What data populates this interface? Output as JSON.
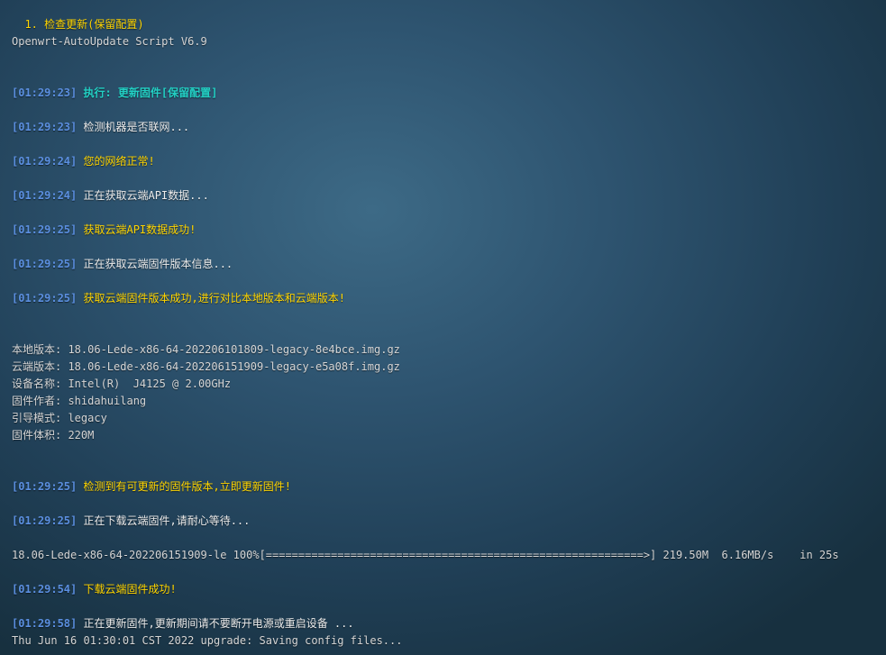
{
  "colors": {
    "timestamp": "#5b8fe0",
    "info_text": "#ececec",
    "success_text": "#ffd500",
    "action_text": "#22d0c4",
    "plain_text": "#d6d6d6"
  },
  "header": {
    "menu_choice": "  1. 检查更新(保留配置)",
    "script_title": "Openwrt-AutoUpdate Script V6.9"
  },
  "log": [
    {
      "ts": "[01:29:23]",
      "msg": "执行: 更新固件[保留配置]"
    },
    {
      "ts": "[01:29:23]",
      "msg": "检测机器是否联网..."
    },
    {
      "ts": "[01:29:24]",
      "msg": "您的网络正常!"
    },
    {
      "ts": "[01:29:24]",
      "msg": "正在获取云端API数据..."
    },
    {
      "ts": "[01:29:25]",
      "msg": "获取云端API数据成功!"
    },
    {
      "ts": "[01:29:25]",
      "msg": "正在获取云端固件版本信息..."
    },
    {
      "ts": "[01:29:25]",
      "msg": "获取云端固件版本成功,进行对比本地版本和云端版本!"
    },
    {
      "ts": "[01:29:25]",
      "msg": "检测到有可更新的固件版本,立即更新固件!"
    },
    {
      "ts": "[01:29:25]",
      "msg": "正在下载云端固件,请耐心等待..."
    },
    {
      "ts": "[01:29:54]",
      "msg": "下载云端固件成功!"
    },
    {
      "ts": "[01:29:58]",
      "msg": "正在更新固件,更新期间请不要断开电源或重启设备 ..."
    }
  ],
  "info": [
    "本地版本: 18.06-Lede-x86-64-202206101809-legacy-8e4bce.img.gz",
    "云端版本: 18.06-Lede-x86-64-202206151909-legacy-e5a08f.img.gz",
    "设备名称: Intel(R)  J4125 @ 2.00GHz",
    "固件作者: shidahuilang",
    "引导模式: legacy",
    "固件体积: 220M"
  ],
  "download": {
    "filename": "18.06-Lede-x86-64-202206151909-le",
    "percent": "100%",
    "progress_fraction": 1.0,
    "bar": "[==========================================================>]",
    "size": "219.50M",
    "speed": "6.16MB/s",
    "time": "in 25s"
  },
  "footer": "Thu Jun 16 01:30:01 CST 2022 upgrade: Saving config files..."
}
